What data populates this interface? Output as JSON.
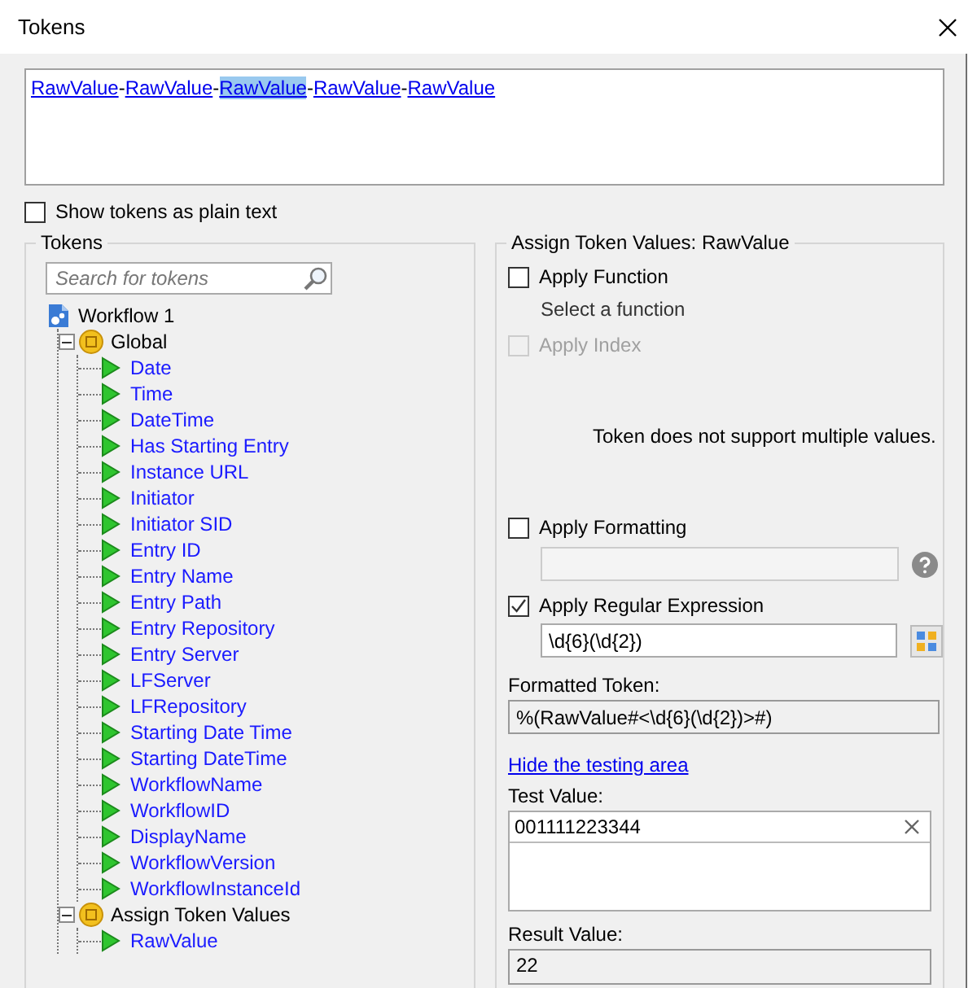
{
  "window": {
    "title": "Tokens"
  },
  "expression": [
    {
      "kind": "token",
      "text": "RawValue",
      "selected": false
    },
    {
      "kind": "separator",
      "text": "-"
    },
    {
      "kind": "token",
      "text": "RawValue",
      "selected": false
    },
    {
      "kind": "separator",
      "text": "-"
    },
    {
      "kind": "token",
      "text": "RawValue",
      "selected": true
    },
    {
      "kind": "separator",
      "text": "-"
    },
    {
      "kind": "token",
      "text": "RawValue",
      "selected": false
    },
    {
      "kind": "separator",
      "text": "-"
    },
    {
      "kind": "token",
      "text": "RawValue",
      "selected": false
    }
  ],
  "plain_text_option": {
    "label": "Show tokens as plain text",
    "checked": false
  },
  "tokens_panel": {
    "title": "Tokens",
    "search": {
      "placeholder": "Search for tokens"
    },
    "tree": [
      {
        "kind": "workflow",
        "label": "Workflow 1",
        "children": [
          {
            "kind": "group",
            "label": "Global",
            "expanded": true,
            "children": [
              {
                "kind": "token",
                "label": "Date"
              },
              {
                "kind": "token",
                "label": "Time"
              },
              {
                "kind": "token",
                "label": "DateTime"
              },
              {
                "kind": "token",
                "label": "Has Starting Entry"
              },
              {
                "kind": "token",
                "label": "Instance URL"
              },
              {
                "kind": "token",
                "label": "Initiator"
              },
              {
                "kind": "token",
                "label": "Initiator SID"
              },
              {
                "kind": "token",
                "label": "Entry ID"
              },
              {
                "kind": "token",
                "label": "Entry Name"
              },
              {
                "kind": "token",
                "label": "Entry Path"
              },
              {
                "kind": "token",
                "label": "Entry Repository"
              },
              {
                "kind": "token",
                "label": "Entry Server"
              },
              {
                "kind": "token",
                "label": "LFServer"
              },
              {
                "kind": "token",
                "label": "LFRepository"
              },
              {
                "kind": "token",
                "label": "Starting Date Time"
              },
              {
                "kind": "token",
                "label": "Starting DateTime"
              },
              {
                "kind": "token",
                "label": "WorkflowName"
              },
              {
                "kind": "token",
                "label": "WorkflowID"
              },
              {
                "kind": "token",
                "label": "DisplayName"
              },
              {
                "kind": "token",
                "label": "WorkflowVersion"
              },
              {
                "kind": "token",
                "label": "WorkflowInstanceId"
              }
            ]
          },
          {
            "kind": "group",
            "label": "Assign Token Values",
            "expanded": true,
            "children": [
              {
                "kind": "token",
                "label": "RawValue"
              }
            ]
          }
        ]
      }
    ]
  },
  "assign_panel": {
    "title": "Assign Token Values: RawValue",
    "apply_function": {
      "label": "Apply Function",
      "checked": false,
      "disabled": false,
      "hint": "Select a function"
    },
    "apply_index": {
      "label": "Apply Index",
      "checked": false,
      "disabled": true
    },
    "message": "Token does not support multiple values.",
    "apply_formatting": {
      "label": "Apply Formatting",
      "checked": false,
      "disabled": false
    },
    "apply_regex": {
      "label": "Apply Regular Expression",
      "checked": true,
      "disabled": false,
      "value": "\\d{6}(\\d{2})"
    },
    "formatted_token": {
      "label": "Formatted Token:",
      "value": "%(RawValue#<\\d{6}(\\d{2})>#)"
    },
    "testing_link": "Hide the testing area",
    "test_value": {
      "label": "Test Value:",
      "value": "001111223344"
    },
    "result_value": {
      "label": "Result Value:",
      "value": "22"
    }
  }
}
